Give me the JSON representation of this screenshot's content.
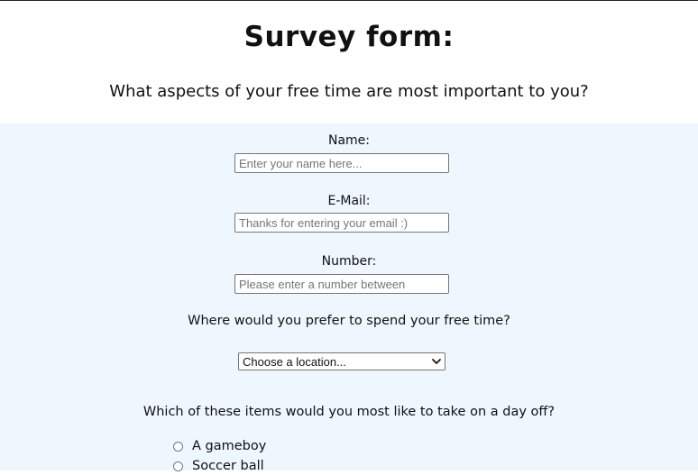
{
  "header": {
    "title": "Survey form:",
    "subtitle": "What aspects of your free time are most important to you?"
  },
  "form": {
    "name": {
      "label": "Name:",
      "placeholder": "Enter your name here..."
    },
    "email": {
      "label": "E-Mail:",
      "placeholder": "Thanks for entering your email :)"
    },
    "number": {
      "label": "Number:",
      "placeholder": "Please enter a number between"
    },
    "location": {
      "question": "Where would you prefer to spend your free time?",
      "selected": "Choose a location..."
    },
    "items": {
      "question": "Which of these items would you most like to take on a day off?",
      "options": [
        "A gameboy",
        "Soccer ball"
      ]
    }
  },
  "colors": {
    "page_background": "#ffffff",
    "form_background": "#eef6fe",
    "input_border": "#767676"
  }
}
